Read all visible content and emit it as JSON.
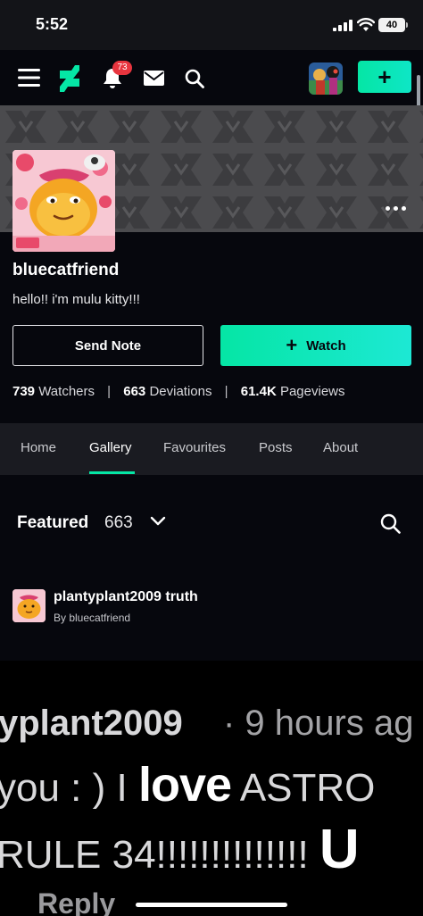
{
  "status_bar": {
    "time": "5:52",
    "battery": "40"
  },
  "top_nav": {
    "notification_count": "73",
    "submit_label": "+"
  },
  "profile": {
    "username": "bluecatfriend",
    "bio": "hello!! i'm mulu kitty!!!",
    "send_note_label": "Send Note",
    "watch_label": "Watch",
    "watch_icon": "+",
    "stats": {
      "watchers_count": "739",
      "watchers_label": "Watchers",
      "deviations_count": "663",
      "deviations_label": "Deviations",
      "pageviews_count": "61.4K",
      "pageviews_label": "Pageviews",
      "separator": "|"
    }
  },
  "tabs": [
    {
      "label": "Home",
      "active": false
    },
    {
      "label": "Gallery",
      "active": true
    },
    {
      "label": "Favourites",
      "active": false
    },
    {
      "label": "Posts",
      "active": false
    },
    {
      "label": "About",
      "active": false
    }
  ],
  "gallery": {
    "section_title": "Featured",
    "count": "663",
    "deviation": {
      "title": "plantyplant2009 truth",
      "byline": "By bluecatfriend"
    },
    "preview_text": {
      "line1_name": "yplant2009",
      "line1_meta": "· 9 hours ag",
      "line2_a": "you : ) I ",
      "line2_big": "love",
      "line2_b": " ASTRO",
      "line3_a": "RULE 34!!!!!!!!!!!!!! ",
      "line3_big": "U",
      "line4": "Reply"
    }
  },
  "colors": {
    "accent": "#05e6a5",
    "badge": "#e8353f",
    "background": "#06070d",
    "tab_bar": "#1a1b21"
  }
}
